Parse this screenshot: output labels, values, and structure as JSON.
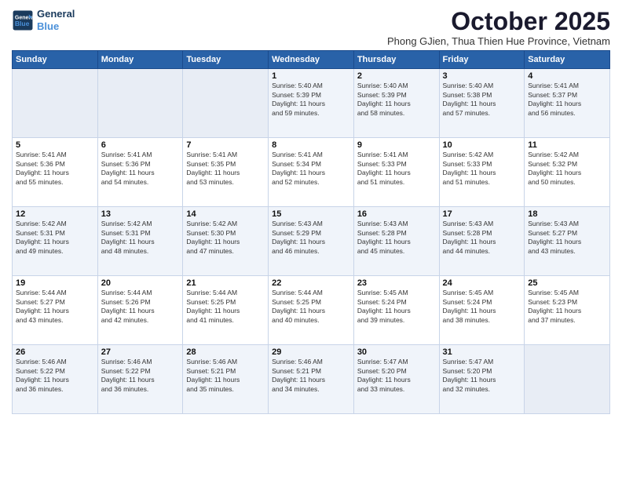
{
  "header": {
    "logo_line1": "General",
    "logo_line2": "Blue",
    "month_title": "October 2025",
    "subtitle": "Phong GJien, Thua Thien Hue Province, Vietnam"
  },
  "weekdays": [
    "Sunday",
    "Monday",
    "Tuesday",
    "Wednesday",
    "Thursday",
    "Friday",
    "Saturday"
  ],
  "weeks": [
    [
      {
        "day": "",
        "info": ""
      },
      {
        "day": "",
        "info": ""
      },
      {
        "day": "",
        "info": ""
      },
      {
        "day": "1",
        "info": "Sunrise: 5:40 AM\nSunset: 5:39 PM\nDaylight: 11 hours\nand 59 minutes."
      },
      {
        "day": "2",
        "info": "Sunrise: 5:40 AM\nSunset: 5:39 PM\nDaylight: 11 hours\nand 58 minutes."
      },
      {
        "day": "3",
        "info": "Sunrise: 5:40 AM\nSunset: 5:38 PM\nDaylight: 11 hours\nand 57 minutes."
      },
      {
        "day": "4",
        "info": "Sunrise: 5:41 AM\nSunset: 5:37 PM\nDaylight: 11 hours\nand 56 minutes."
      }
    ],
    [
      {
        "day": "5",
        "info": "Sunrise: 5:41 AM\nSunset: 5:36 PM\nDaylight: 11 hours\nand 55 minutes."
      },
      {
        "day": "6",
        "info": "Sunrise: 5:41 AM\nSunset: 5:36 PM\nDaylight: 11 hours\nand 54 minutes."
      },
      {
        "day": "7",
        "info": "Sunrise: 5:41 AM\nSunset: 5:35 PM\nDaylight: 11 hours\nand 53 minutes."
      },
      {
        "day": "8",
        "info": "Sunrise: 5:41 AM\nSunset: 5:34 PM\nDaylight: 11 hours\nand 52 minutes."
      },
      {
        "day": "9",
        "info": "Sunrise: 5:41 AM\nSunset: 5:33 PM\nDaylight: 11 hours\nand 51 minutes."
      },
      {
        "day": "10",
        "info": "Sunrise: 5:42 AM\nSunset: 5:33 PM\nDaylight: 11 hours\nand 51 minutes."
      },
      {
        "day": "11",
        "info": "Sunrise: 5:42 AM\nSunset: 5:32 PM\nDaylight: 11 hours\nand 50 minutes."
      }
    ],
    [
      {
        "day": "12",
        "info": "Sunrise: 5:42 AM\nSunset: 5:31 PM\nDaylight: 11 hours\nand 49 minutes."
      },
      {
        "day": "13",
        "info": "Sunrise: 5:42 AM\nSunset: 5:31 PM\nDaylight: 11 hours\nand 48 minutes."
      },
      {
        "day": "14",
        "info": "Sunrise: 5:42 AM\nSunset: 5:30 PM\nDaylight: 11 hours\nand 47 minutes."
      },
      {
        "day": "15",
        "info": "Sunrise: 5:43 AM\nSunset: 5:29 PM\nDaylight: 11 hours\nand 46 minutes."
      },
      {
        "day": "16",
        "info": "Sunrise: 5:43 AM\nSunset: 5:28 PM\nDaylight: 11 hours\nand 45 minutes."
      },
      {
        "day": "17",
        "info": "Sunrise: 5:43 AM\nSunset: 5:28 PM\nDaylight: 11 hours\nand 44 minutes."
      },
      {
        "day": "18",
        "info": "Sunrise: 5:43 AM\nSunset: 5:27 PM\nDaylight: 11 hours\nand 43 minutes."
      }
    ],
    [
      {
        "day": "19",
        "info": "Sunrise: 5:44 AM\nSunset: 5:27 PM\nDaylight: 11 hours\nand 43 minutes."
      },
      {
        "day": "20",
        "info": "Sunrise: 5:44 AM\nSunset: 5:26 PM\nDaylight: 11 hours\nand 42 minutes."
      },
      {
        "day": "21",
        "info": "Sunrise: 5:44 AM\nSunset: 5:25 PM\nDaylight: 11 hours\nand 41 minutes."
      },
      {
        "day": "22",
        "info": "Sunrise: 5:44 AM\nSunset: 5:25 PM\nDaylight: 11 hours\nand 40 minutes."
      },
      {
        "day": "23",
        "info": "Sunrise: 5:45 AM\nSunset: 5:24 PM\nDaylight: 11 hours\nand 39 minutes."
      },
      {
        "day": "24",
        "info": "Sunrise: 5:45 AM\nSunset: 5:24 PM\nDaylight: 11 hours\nand 38 minutes."
      },
      {
        "day": "25",
        "info": "Sunrise: 5:45 AM\nSunset: 5:23 PM\nDaylight: 11 hours\nand 37 minutes."
      }
    ],
    [
      {
        "day": "26",
        "info": "Sunrise: 5:46 AM\nSunset: 5:22 PM\nDaylight: 11 hours\nand 36 minutes."
      },
      {
        "day": "27",
        "info": "Sunrise: 5:46 AM\nSunset: 5:22 PM\nDaylight: 11 hours\nand 36 minutes."
      },
      {
        "day": "28",
        "info": "Sunrise: 5:46 AM\nSunset: 5:21 PM\nDaylight: 11 hours\nand 35 minutes."
      },
      {
        "day": "29",
        "info": "Sunrise: 5:46 AM\nSunset: 5:21 PM\nDaylight: 11 hours\nand 34 minutes."
      },
      {
        "day": "30",
        "info": "Sunrise: 5:47 AM\nSunset: 5:20 PM\nDaylight: 11 hours\nand 33 minutes."
      },
      {
        "day": "31",
        "info": "Sunrise: 5:47 AM\nSunset: 5:20 PM\nDaylight: 11 hours\nand 32 minutes."
      },
      {
        "day": "",
        "info": ""
      }
    ]
  ]
}
